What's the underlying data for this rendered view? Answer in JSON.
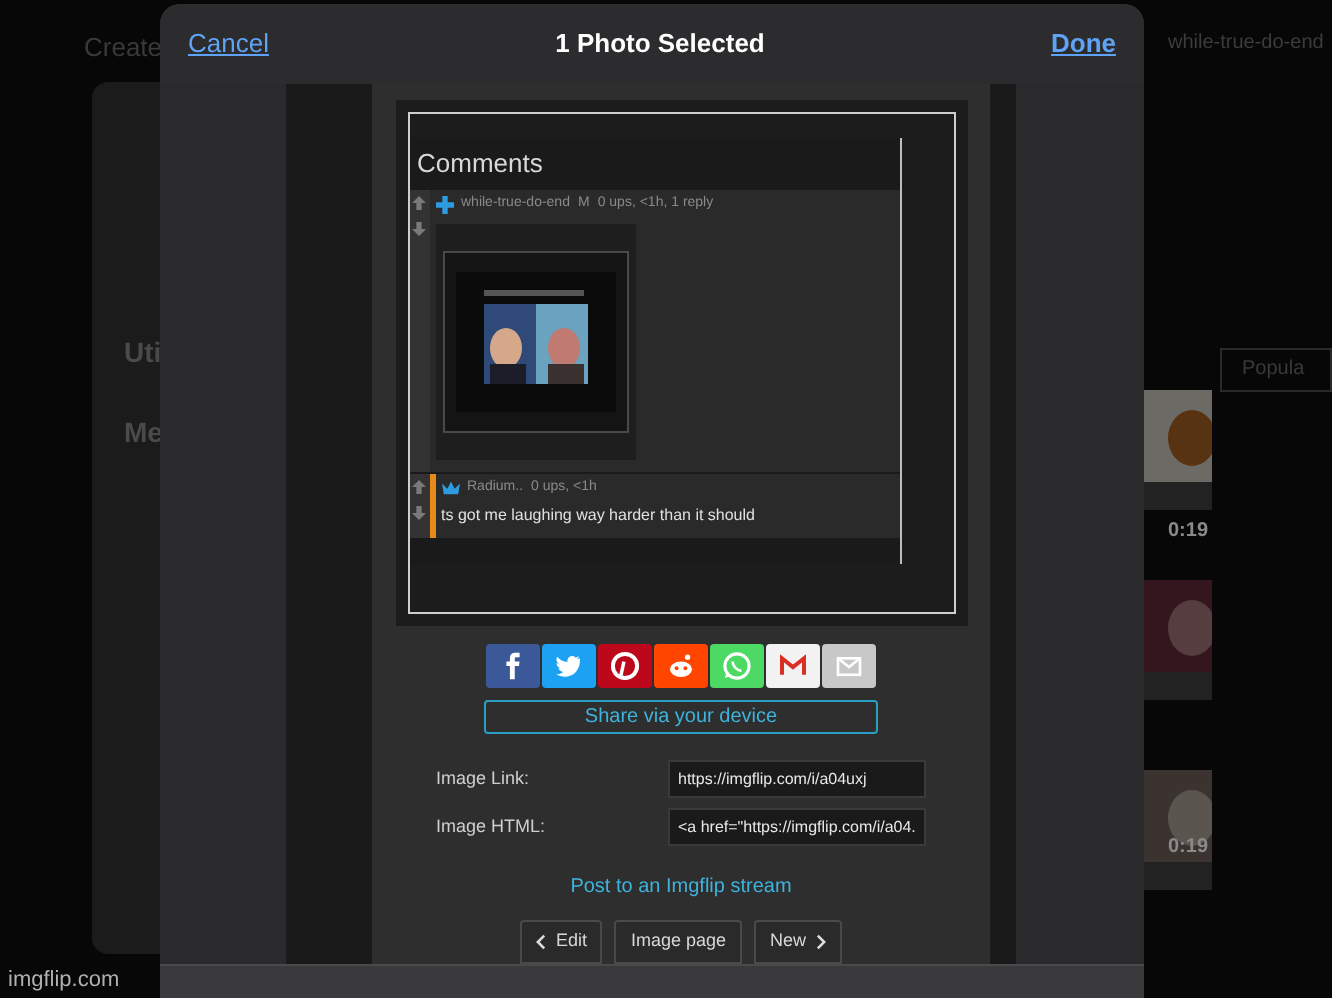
{
  "background": {
    "nav_link": "Create",
    "user": "while-true-do-end",
    "menu_labels": [
      "Uti",
      "Me"
    ],
    "tab": "Popula",
    "durations": [
      "0:19",
      "0:19"
    ],
    "address": "imgflip.com"
  },
  "sheet": {
    "cancel": "Cancel",
    "title": "1 Photo Selected",
    "done": "Done"
  },
  "preview": {
    "comments_title": "Comments",
    "comments": [
      {
        "user": "while-true-do-end",
        "badge": "M",
        "meta": "0 ups, <1h, 1 reply"
      },
      {
        "kind": "text",
        "user": "Radium..",
        "meta": "0 ups, <1h",
        "text": "ts got me laughing way harder than it should"
      }
    ]
  },
  "share_device": "Share via your device",
  "fields": [
    {
      "label": "Image Link:",
      "value": "https://imgflip.com/i/a04uxj"
    },
    {
      "label": "Image HTML:",
      "value": "<a href=\"https://imgflip.com/i/a04."
    }
  ],
  "stream_link": "Post to an Imgflip stream",
  "nav_buttons": [
    {
      "kind": "back",
      "label": "Edit"
    },
    {
      "kind": "plain",
      "label": "Image page"
    },
    {
      "kind": "forward",
      "label": "New"
    }
  ]
}
